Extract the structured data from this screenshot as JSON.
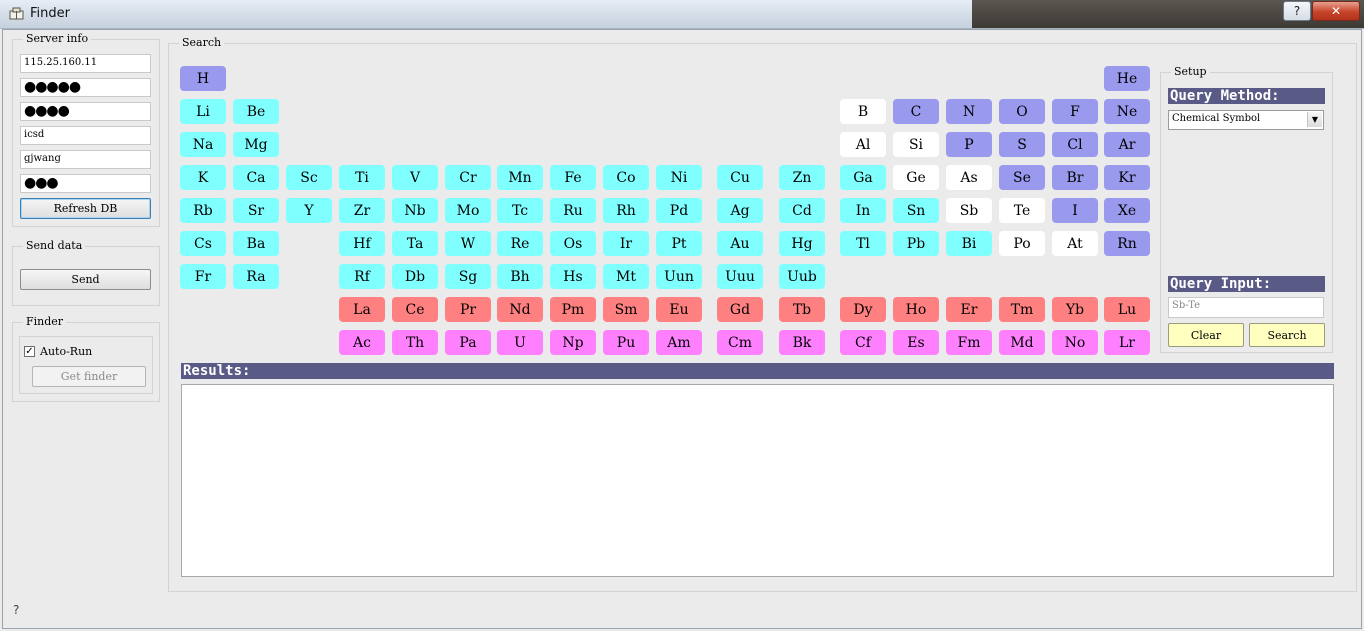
{
  "window": {
    "title": "Finder",
    "help_label": "?",
    "close_label": "✕"
  },
  "server_info": {
    "label": "Server info",
    "host": "115.25.160.11",
    "field2_masked": "●●●●●",
    "field3_masked": "●●●●",
    "database": "icsd",
    "user": "gjwang",
    "password_masked": "●●●",
    "refresh_button": "Refresh DB"
  },
  "send_data": {
    "label": "Send data",
    "send_button": "Send"
  },
  "finder": {
    "label": "Finder",
    "auto_run_label": "Auto-Run",
    "auto_run_checked": true,
    "get_finder_button": "Get finder"
  },
  "search": {
    "label": "Search",
    "elements": [
      {
        "s": "H",
        "c": "#9999ee",
        "row": 0,
        "col": 0
      },
      {
        "s": "He",
        "c": "#9999ee",
        "row": 0,
        "col": 17
      },
      {
        "s": "Li",
        "c": "#80ffff",
        "row": 1,
        "col": 0
      },
      {
        "s": "Be",
        "c": "#80ffff",
        "row": 1,
        "col": 1
      },
      {
        "s": "B",
        "c": "#ffffff",
        "row": 1,
        "col": 12
      },
      {
        "s": "C",
        "c": "#9999ee",
        "row": 1,
        "col": 13
      },
      {
        "s": "N",
        "c": "#9999ee",
        "row": 1,
        "col": 14
      },
      {
        "s": "O",
        "c": "#9999ee",
        "row": 1,
        "col": 15
      },
      {
        "s": "F",
        "c": "#9999ee",
        "row": 1,
        "col": 16
      },
      {
        "s": "Ne",
        "c": "#9999ee",
        "row": 1,
        "col": 17
      },
      {
        "s": "Na",
        "c": "#80ffff",
        "row": 2,
        "col": 0
      },
      {
        "s": "Mg",
        "c": "#80ffff",
        "row": 2,
        "col": 1
      },
      {
        "s": "Al",
        "c": "#ffffff",
        "row": 2,
        "col": 12
      },
      {
        "s": "Si",
        "c": "#ffffff",
        "row": 2,
        "col": 13
      },
      {
        "s": "P",
        "c": "#9999ee",
        "row": 2,
        "col": 14
      },
      {
        "s": "S",
        "c": "#9999ee",
        "row": 2,
        "col": 15
      },
      {
        "s": "Cl",
        "c": "#9999ee",
        "row": 2,
        "col": 16
      },
      {
        "s": "Ar",
        "c": "#9999ee",
        "row": 2,
        "col": 17
      },
      {
        "s": "K",
        "c": "#80ffff",
        "row": 3,
        "col": 0
      },
      {
        "s": "Ca",
        "c": "#80ffff",
        "row": 3,
        "col": 1
      },
      {
        "s": "Sc",
        "c": "#80ffff",
        "row": 3,
        "col": 2
      },
      {
        "s": "Ti",
        "c": "#80ffff",
        "row": 3,
        "col": 3
      },
      {
        "s": "V",
        "c": "#80ffff",
        "row": 3,
        "col": 4
      },
      {
        "s": "Cr",
        "c": "#80ffff",
        "row": 3,
        "col": 5
      },
      {
        "s": "Mn",
        "c": "#80ffff",
        "row": 3,
        "col": 6
      },
      {
        "s": "Fe",
        "c": "#80ffff",
        "row": 3,
        "col": 7
      },
      {
        "s": "Co",
        "c": "#80ffff",
        "row": 3,
        "col": 8
      },
      {
        "s": "Ni",
        "c": "#80ffff",
        "row": 3,
        "col": 9
      },
      {
        "s": "Cu",
        "c": "#80ffff",
        "row": 3,
        "col": 10
      },
      {
        "s": "Zn",
        "c": "#80ffff",
        "row": 3,
        "col": 11
      },
      {
        "s": "Ga",
        "c": "#80ffff",
        "row": 3,
        "col": 12
      },
      {
        "s": "Ge",
        "c": "#ffffff",
        "row": 3,
        "col": 13
      },
      {
        "s": "As",
        "c": "#ffffff",
        "row": 3,
        "col": 14
      },
      {
        "s": "Se",
        "c": "#9999ee",
        "row": 3,
        "col": 15
      },
      {
        "s": "Br",
        "c": "#9999ee",
        "row": 3,
        "col": 16
      },
      {
        "s": "Kr",
        "c": "#9999ee",
        "row": 3,
        "col": 17
      },
      {
        "s": "Rb",
        "c": "#80ffff",
        "row": 4,
        "col": 0
      },
      {
        "s": "Sr",
        "c": "#80ffff",
        "row": 4,
        "col": 1
      },
      {
        "s": "Y",
        "c": "#80ffff",
        "row": 4,
        "col": 2
      },
      {
        "s": "Zr",
        "c": "#80ffff",
        "row": 4,
        "col": 3
      },
      {
        "s": "Nb",
        "c": "#80ffff",
        "row": 4,
        "col": 4
      },
      {
        "s": "Mo",
        "c": "#80ffff",
        "row": 4,
        "col": 5
      },
      {
        "s": "Tc",
        "c": "#80ffff",
        "row": 4,
        "col": 6
      },
      {
        "s": "Ru",
        "c": "#80ffff",
        "row": 4,
        "col": 7
      },
      {
        "s": "Rh",
        "c": "#80ffff",
        "row": 4,
        "col": 8
      },
      {
        "s": "Pd",
        "c": "#80ffff",
        "row": 4,
        "col": 9
      },
      {
        "s": "Ag",
        "c": "#80ffff",
        "row": 4,
        "col": 10
      },
      {
        "s": "Cd",
        "c": "#80ffff",
        "row": 4,
        "col": 11
      },
      {
        "s": "In",
        "c": "#80ffff",
        "row": 4,
        "col": 12
      },
      {
        "s": "Sn",
        "c": "#80ffff",
        "row": 4,
        "col": 13
      },
      {
        "s": "Sb",
        "c": "#ffffff",
        "row": 4,
        "col": 14
      },
      {
        "s": "Te",
        "c": "#ffffff",
        "row": 4,
        "col": 15
      },
      {
        "s": "I",
        "c": "#9999ee",
        "row": 4,
        "col": 16
      },
      {
        "s": "Xe",
        "c": "#9999ee",
        "row": 4,
        "col": 17
      },
      {
        "s": "Cs",
        "c": "#80ffff",
        "row": 5,
        "col": 0
      },
      {
        "s": "Ba",
        "c": "#80ffff",
        "row": 5,
        "col": 1
      },
      {
        "s": "Hf",
        "c": "#80ffff",
        "row": 5,
        "col": 3
      },
      {
        "s": "Ta",
        "c": "#80ffff",
        "row": 5,
        "col": 4
      },
      {
        "s": "W",
        "c": "#80ffff",
        "row": 5,
        "col": 5
      },
      {
        "s": "Re",
        "c": "#80ffff",
        "row": 5,
        "col": 6
      },
      {
        "s": "Os",
        "c": "#80ffff",
        "row": 5,
        "col": 7
      },
      {
        "s": "Ir",
        "c": "#80ffff",
        "row": 5,
        "col": 8
      },
      {
        "s": "Pt",
        "c": "#80ffff",
        "row": 5,
        "col": 9
      },
      {
        "s": "Au",
        "c": "#80ffff",
        "row": 5,
        "col": 10
      },
      {
        "s": "Hg",
        "c": "#80ffff",
        "row": 5,
        "col": 11
      },
      {
        "s": "Tl",
        "c": "#80ffff",
        "row": 5,
        "col": 12
      },
      {
        "s": "Pb",
        "c": "#80ffff",
        "row": 5,
        "col": 13
      },
      {
        "s": "Bi",
        "c": "#80ffff",
        "row": 5,
        "col": 14
      },
      {
        "s": "Po",
        "c": "#ffffff",
        "row": 5,
        "col": 15
      },
      {
        "s": "At",
        "c": "#ffffff",
        "row": 5,
        "col": 16
      },
      {
        "s": "Rn",
        "c": "#9999ee",
        "row": 5,
        "col": 17
      },
      {
        "s": "Fr",
        "c": "#80ffff",
        "row": 6,
        "col": 0
      },
      {
        "s": "Ra",
        "c": "#80ffff",
        "row": 6,
        "col": 1
      },
      {
        "s": "Rf",
        "c": "#80ffff",
        "row": 6,
        "col": 3
      },
      {
        "s": "Db",
        "c": "#80ffff",
        "row": 6,
        "col": 4
      },
      {
        "s": "Sg",
        "c": "#80ffff",
        "row": 6,
        "col": 5
      },
      {
        "s": "Bh",
        "c": "#80ffff",
        "row": 6,
        "col": 6
      },
      {
        "s": "Hs",
        "c": "#80ffff",
        "row": 6,
        "col": 7
      },
      {
        "s": "Mt",
        "c": "#80ffff",
        "row": 6,
        "col": 8
      },
      {
        "s": "Uun",
        "c": "#80ffff",
        "row": 6,
        "col": 9
      },
      {
        "s": "Uuu",
        "c": "#80ffff",
        "row": 6,
        "col": 10
      },
      {
        "s": "Uub",
        "c": "#80ffff",
        "row": 6,
        "col": 11
      },
      {
        "s": "La",
        "c": "#ff8080",
        "row": 7,
        "col": 3
      },
      {
        "s": "Ce",
        "c": "#ff8080",
        "row": 7,
        "col": 4
      },
      {
        "s": "Pr",
        "c": "#ff8080",
        "row": 7,
        "col": 5
      },
      {
        "s": "Nd",
        "c": "#ff8080",
        "row": 7,
        "col": 6
      },
      {
        "s": "Pm",
        "c": "#ff8080",
        "row": 7,
        "col": 7
      },
      {
        "s": "Sm",
        "c": "#ff8080",
        "row": 7,
        "col": 8
      },
      {
        "s": "Eu",
        "c": "#ff8080",
        "row": 7,
        "col": 9
      },
      {
        "s": "Gd",
        "c": "#ff8080",
        "row": 7,
        "col": 10
      },
      {
        "s": "Tb",
        "c": "#ff8080",
        "row": 7,
        "col": 11
      },
      {
        "s": "Dy",
        "c": "#ff8080",
        "row": 7,
        "col": 12
      },
      {
        "s": "Ho",
        "c": "#ff8080",
        "row": 7,
        "col": 13
      },
      {
        "s": "Er",
        "c": "#ff8080",
        "row": 7,
        "col": 14
      },
      {
        "s": "Tm",
        "c": "#ff8080",
        "row": 7,
        "col": 15
      },
      {
        "s": "Yb",
        "c": "#ff8080",
        "row": 7,
        "col": 16
      },
      {
        "s": "Lu",
        "c": "#ff8080",
        "row": 7,
        "col": 17
      },
      {
        "s": "Ac",
        "c": "#ff80ff",
        "row": 8,
        "col": 3
      },
      {
        "s": "Th",
        "c": "#ff80ff",
        "row": 8,
        "col": 4
      },
      {
        "s": "Pa",
        "c": "#ff80ff",
        "row": 8,
        "col": 5
      },
      {
        "s": "U",
        "c": "#ff80ff",
        "row": 8,
        "col": 6
      },
      {
        "s": "Np",
        "c": "#ff80ff",
        "row": 8,
        "col": 7
      },
      {
        "s": "Pu",
        "c": "#ff80ff",
        "row": 8,
        "col": 8
      },
      {
        "s": "Am",
        "c": "#ff80ff",
        "row": 8,
        "col": 9
      },
      {
        "s": "Cm",
        "c": "#ff80ff",
        "row": 8,
        "col": 10
      },
      {
        "s": "Bk",
        "c": "#ff80ff",
        "row": 8,
        "col": 11
      },
      {
        "s": "Cf",
        "c": "#ff80ff",
        "row": 8,
        "col": 12
      },
      {
        "s": "Es",
        "c": "#ff80ff",
        "row": 8,
        "col": 13
      },
      {
        "s": "Fm",
        "c": "#ff80ff",
        "row": 8,
        "col": 14
      },
      {
        "s": "Md",
        "c": "#ff80ff",
        "row": 8,
        "col": 15
      },
      {
        "s": "No",
        "c": "#ff80ff",
        "row": 8,
        "col": 16
      },
      {
        "s": "Lr",
        "c": "#ff80ff",
        "row": 8,
        "col": 17
      }
    ]
  },
  "setup": {
    "label": "Setup",
    "query_method_header": "Query Method:",
    "query_method_value": "Chemical Symbol",
    "query_input_header": "Query Input:",
    "query_input_placeholder": "Sb-Te",
    "clear_button": "Clear",
    "search_button": "Search"
  },
  "results": {
    "header": "Results:",
    "content": ""
  },
  "statusbar": {
    "help_glyph": "?"
  }
}
